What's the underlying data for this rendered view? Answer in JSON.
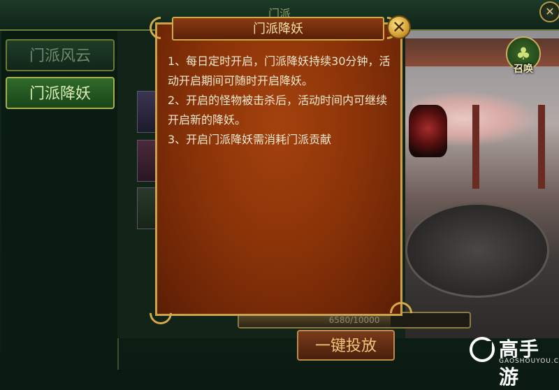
{
  "window": {
    "title_fragment": "门派",
    "close_icon": "close-icon"
  },
  "left_nav": {
    "items": [
      {
        "label": "门派风云",
        "active": false
      },
      {
        "label": "门派降妖",
        "active": true
      }
    ]
  },
  "summon": {
    "label": "召唤",
    "icon": "summon-emblem-icon"
  },
  "progress": {
    "text": "6580/10000",
    "fraction": 0.658
  },
  "bottom": {
    "offer_button": "一键投放"
  },
  "logo": {
    "text": "高手游",
    "sub": "GAOSHOUYOU.COM"
  },
  "modal": {
    "title": "门派降妖",
    "close_icon": "close-icon",
    "lines": [
      "1、每日定时开启，门派降妖持续30分钟，活动开启期间可随时开启降妖。",
      "2、开启的怪物被击杀后，活动时间内可继续开启新的降妖。",
      "3、开启门派降妖需消耗门派贡献"
    ]
  },
  "colors": {
    "accent_gold": "#c9a24a",
    "modal_red": "#8c3408",
    "nav_active": "#2f6a2a"
  }
}
